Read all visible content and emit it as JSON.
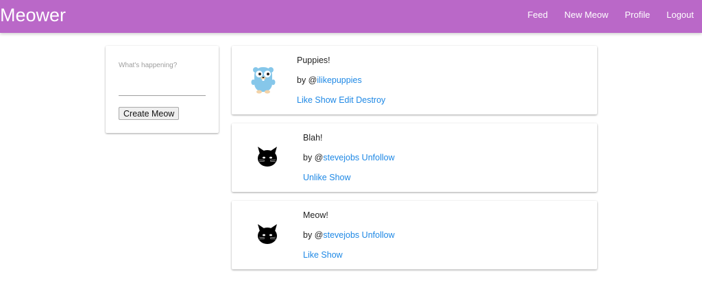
{
  "app": {
    "brand": "Meower"
  },
  "nav": {
    "items": [
      "Feed",
      "New Meow",
      "Profile",
      "Logout"
    ]
  },
  "compose": {
    "placeholder": "What's happening?",
    "value": "",
    "button_label": "Create Meow"
  },
  "colors": {
    "navbar": "#ba68c8",
    "link": "#1e88e5"
  },
  "meows": [
    {
      "text": "Puppies!",
      "by_prefix": "by @",
      "handle": "ilikepuppies",
      "follow_label": "",
      "actions": [
        "Like",
        "Show",
        "Edit",
        "Destroy"
      ],
      "avatar_icon": "gopher-icon"
    },
    {
      "text": "Blah!",
      "by_prefix": "by @",
      "handle": "stevejobs",
      "follow_label": "Unfollow",
      "actions": [
        "Unlike",
        "Show"
      ],
      "avatar_icon": "black-cat-icon"
    },
    {
      "text": "Meow!",
      "by_prefix": "by @",
      "handle": "stevejobs",
      "follow_label": "Unfollow",
      "actions": [
        "Like",
        "Show"
      ],
      "avatar_icon": "black-cat-icon"
    }
  ]
}
